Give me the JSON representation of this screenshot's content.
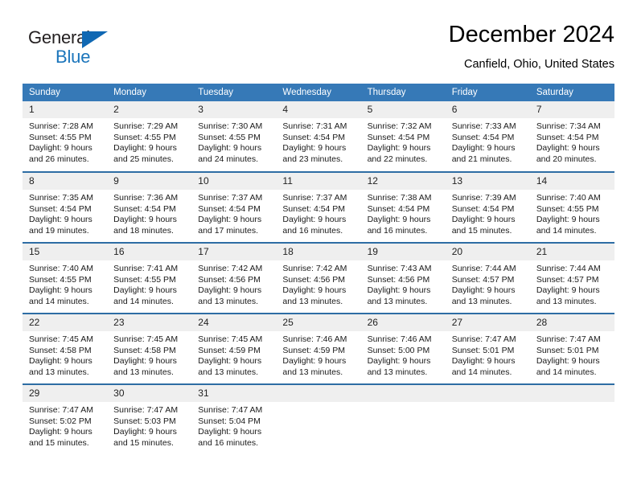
{
  "logo": {
    "word1": "General",
    "word2": "Blue",
    "triangle_color": "#1068b3",
    "word2_color": "#1b75bb"
  },
  "header": {
    "title": "December 2024",
    "subtitle": "Canfield, Ohio, United States"
  },
  "colors": {
    "header_row_background": "#3679b7",
    "header_row_text": "#ffffff",
    "row_top_border": "#2e6da4",
    "daynumber_band": "#efefef",
    "cell_background": "#ffffff",
    "body_text": "#1a1a1a"
  },
  "weekday_headers": [
    "Sunday",
    "Monday",
    "Tuesday",
    "Wednesday",
    "Thursday",
    "Friday",
    "Saturday"
  ],
  "weeks": [
    [
      {
        "day": "1",
        "sunrise": "Sunrise: 7:28 AM",
        "sunset": "Sunset: 4:55 PM",
        "daylight": "Daylight: 9 hours and 26 minutes."
      },
      {
        "day": "2",
        "sunrise": "Sunrise: 7:29 AM",
        "sunset": "Sunset: 4:55 PM",
        "daylight": "Daylight: 9 hours and 25 minutes."
      },
      {
        "day": "3",
        "sunrise": "Sunrise: 7:30 AM",
        "sunset": "Sunset: 4:55 PM",
        "daylight": "Daylight: 9 hours and 24 minutes."
      },
      {
        "day": "4",
        "sunrise": "Sunrise: 7:31 AM",
        "sunset": "Sunset: 4:54 PM",
        "daylight": "Daylight: 9 hours and 23 minutes."
      },
      {
        "day": "5",
        "sunrise": "Sunrise: 7:32 AM",
        "sunset": "Sunset: 4:54 PM",
        "daylight": "Daylight: 9 hours and 22 minutes."
      },
      {
        "day": "6",
        "sunrise": "Sunrise: 7:33 AM",
        "sunset": "Sunset: 4:54 PM",
        "daylight": "Daylight: 9 hours and 21 minutes."
      },
      {
        "day": "7",
        "sunrise": "Sunrise: 7:34 AM",
        "sunset": "Sunset: 4:54 PM",
        "daylight": "Daylight: 9 hours and 20 minutes."
      }
    ],
    [
      {
        "day": "8",
        "sunrise": "Sunrise: 7:35 AM",
        "sunset": "Sunset: 4:54 PM",
        "daylight": "Daylight: 9 hours and 19 minutes."
      },
      {
        "day": "9",
        "sunrise": "Sunrise: 7:36 AM",
        "sunset": "Sunset: 4:54 PM",
        "daylight": "Daylight: 9 hours and 18 minutes."
      },
      {
        "day": "10",
        "sunrise": "Sunrise: 7:37 AM",
        "sunset": "Sunset: 4:54 PM",
        "daylight": "Daylight: 9 hours and 17 minutes."
      },
      {
        "day": "11",
        "sunrise": "Sunrise: 7:37 AM",
        "sunset": "Sunset: 4:54 PM",
        "daylight": "Daylight: 9 hours and 16 minutes."
      },
      {
        "day": "12",
        "sunrise": "Sunrise: 7:38 AM",
        "sunset": "Sunset: 4:54 PM",
        "daylight": "Daylight: 9 hours and 16 minutes."
      },
      {
        "day": "13",
        "sunrise": "Sunrise: 7:39 AM",
        "sunset": "Sunset: 4:54 PM",
        "daylight": "Daylight: 9 hours and 15 minutes."
      },
      {
        "day": "14",
        "sunrise": "Sunrise: 7:40 AM",
        "sunset": "Sunset: 4:55 PM",
        "daylight": "Daylight: 9 hours and 14 minutes."
      }
    ],
    [
      {
        "day": "15",
        "sunrise": "Sunrise: 7:40 AM",
        "sunset": "Sunset: 4:55 PM",
        "daylight": "Daylight: 9 hours and 14 minutes."
      },
      {
        "day": "16",
        "sunrise": "Sunrise: 7:41 AM",
        "sunset": "Sunset: 4:55 PM",
        "daylight": "Daylight: 9 hours and 14 minutes."
      },
      {
        "day": "17",
        "sunrise": "Sunrise: 7:42 AM",
        "sunset": "Sunset: 4:56 PM",
        "daylight": "Daylight: 9 hours and 13 minutes."
      },
      {
        "day": "18",
        "sunrise": "Sunrise: 7:42 AM",
        "sunset": "Sunset: 4:56 PM",
        "daylight": "Daylight: 9 hours and 13 minutes."
      },
      {
        "day": "19",
        "sunrise": "Sunrise: 7:43 AM",
        "sunset": "Sunset: 4:56 PM",
        "daylight": "Daylight: 9 hours and 13 minutes."
      },
      {
        "day": "20",
        "sunrise": "Sunrise: 7:44 AM",
        "sunset": "Sunset: 4:57 PM",
        "daylight": "Daylight: 9 hours and 13 minutes."
      },
      {
        "day": "21",
        "sunrise": "Sunrise: 7:44 AM",
        "sunset": "Sunset: 4:57 PM",
        "daylight": "Daylight: 9 hours and 13 minutes."
      }
    ],
    [
      {
        "day": "22",
        "sunrise": "Sunrise: 7:45 AM",
        "sunset": "Sunset: 4:58 PM",
        "daylight": "Daylight: 9 hours and 13 minutes."
      },
      {
        "day": "23",
        "sunrise": "Sunrise: 7:45 AM",
        "sunset": "Sunset: 4:58 PM",
        "daylight": "Daylight: 9 hours and 13 minutes."
      },
      {
        "day": "24",
        "sunrise": "Sunrise: 7:45 AM",
        "sunset": "Sunset: 4:59 PM",
        "daylight": "Daylight: 9 hours and 13 minutes."
      },
      {
        "day": "25",
        "sunrise": "Sunrise: 7:46 AM",
        "sunset": "Sunset: 4:59 PM",
        "daylight": "Daylight: 9 hours and 13 minutes."
      },
      {
        "day": "26",
        "sunrise": "Sunrise: 7:46 AM",
        "sunset": "Sunset: 5:00 PM",
        "daylight": "Daylight: 9 hours and 13 minutes."
      },
      {
        "day": "27",
        "sunrise": "Sunrise: 7:47 AM",
        "sunset": "Sunset: 5:01 PM",
        "daylight": "Daylight: 9 hours and 14 minutes."
      },
      {
        "day": "28",
        "sunrise": "Sunrise: 7:47 AM",
        "sunset": "Sunset: 5:01 PM",
        "daylight": "Daylight: 9 hours and 14 minutes."
      }
    ],
    [
      {
        "day": "29",
        "sunrise": "Sunrise: 7:47 AM",
        "sunset": "Sunset: 5:02 PM",
        "daylight": "Daylight: 9 hours and 15 minutes."
      },
      {
        "day": "30",
        "sunrise": "Sunrise: 7:47 AM",
        "sunset": "Sunset: 5:03 PM",
        "daylight": "Daylight: 9 hours and 15 minutes."
      },
      {
        "day": "31",
        "sunrise": "Sunrise: 7:47 AM",
        "sunset": "Sunset: 5:04 PM",
        "daylight": "Daylight: 9 hours and 16 minutes."
      },
      {
        "day": "",
        "sunrise": "",
        "sunset": "",
        "daylight": ""
      },
      {
        "day": "",
        "sunrise": "",
        "sunset": "",
        "daylight": ""
      },
      {
        "day": "",
        "sunrise": "",
        "sunset": "",
        "daylight": ""
      },
      {
        "day": "",
        "sunrise": "",
        "sunset": "",
        "daylight": ""
      }
    ]
  ]
}
